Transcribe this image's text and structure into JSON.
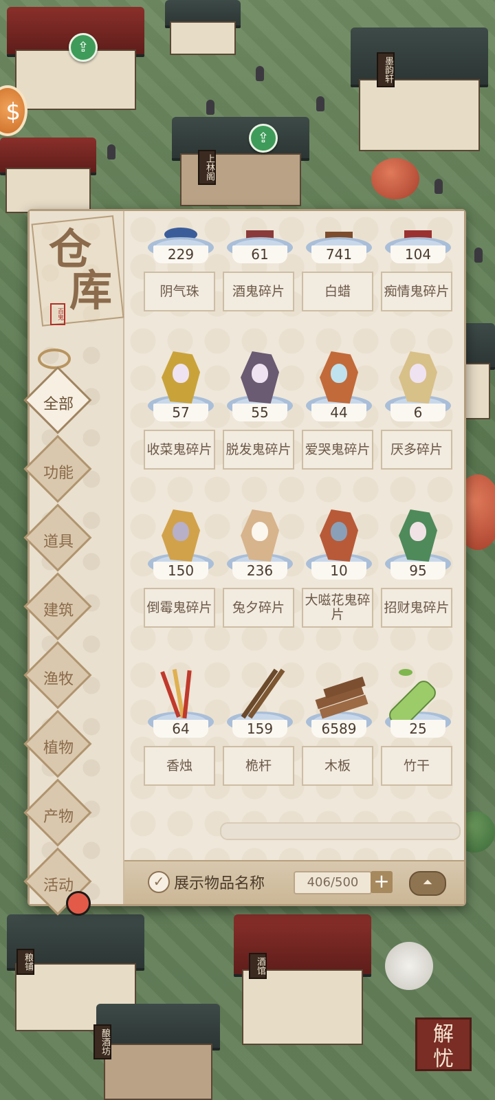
{
  "world": {
    "building_signs": [
      "上林阁",
      "墨韵轩",
      "粮铺",
      "酒馆",
      "酿酒坊"
    ]
  },
  "warehouse": {
    "title": [
      "仓",
      "库"
    ],
    "stamp": "百鬼",
    "tabs": [
      {
        "label": "全部",
        "active": true
      },
      {
        "label": "功能",
        "active": false
      },
      {
        "label": "道具",
        "active": false
      },
      {
        "label": "建筑",
        "active": false
      },
      {
        "label": "渔牧",
        "active": false
      },
      {
        "label": "植物",
        "active": false
      },
      {
        "label": "产物",
        "active": false
      },
      {
        "label": "活动",
        "active": false
      }
    ],
    "items": [
      {
        "name": "阴气珠",
        "count": "229",
        "icon": "orb-icon"
      },
      {
        "name": "酒鬼碎片",
        "count": "61",
        "icon": "ghost-shard-icon"
      },
      {
        "name": "白蜡",
        "count": "741",
        "icon": "wax-icon"
      },
      {
        "name": "痴情鬼碎片",
        "count": "104",
        "icon": "ghost-shard-icon"
      },
      {
        "name": "收菜鬼碎片",
        "count": "57",
        "icon": "ghost-shard-icon"
      },
      {
        "name": "脱发鬼碎片",
        "count": "55",
        "icon": "ghost-shard-icon"
      },
      {
        "name": "爱哭鬼碎片",
        "count": "44",
        "icon": "ghost-shard-icon"
      },
      {
        "name": "厌多碎片",
        "count": "6",
        "icon": "ghost-shard-icon"
      },
      {
        "name": "倒霉鬼碎片",
        "count": "150",
        "icon": "ghost-shard-icon"
      },
      {
        "name": "兔夕碎片",
        "count": "236",
        "icon": "ghost-shard-icon"
      },
      {
        "name": "大嗞花鬼碎片",
        "count": "10",
        "icon": "ghost-shard-icon"
      },
      {
        "name": "招财鬼碎片",
        "count": "95",
        "icon": "ghost-shard-icon"
      },
      {
        "name": "香烛",
        "count": "64",
        "icon": "incense-icon"
      },
      {
        "name": "桅杆",
        "count": "159",
        "icon": "mast-icon"
      },
      {
        "name": "木板",
        "count": "6589",
        "icon": "planks-icon"
      },
      {
        "name": "竹干",
        "count": "25",
        "icon": "bamboo-icon"
      }
    ],
    "show_names_label": "展示物品名称",
    "show_names_checked": true,
    "capacity": "406/500",
    "collapse_glyph": "⏶"
  },
  "corner_button": {
    "label": [
      "解",
      "忧"
    ]
  },
  "colors": {
    "panel": "#ece4d6",
    "accent": "#8f7451",
    "tab_active": "#f6efe2"
  }
}
